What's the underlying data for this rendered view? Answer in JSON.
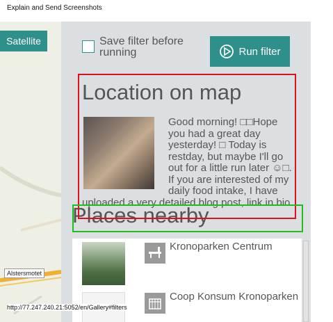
{
  "document": {
    "title": "Explain and Send Screenshots"
  },
  "map": {
    "satellite_label": "Satellite",
    "place_label": "Alstersmotet"
  },
  "filter": {
    "save_filter_label": "Save filter before running",
    "run_filter_label": "Run filter"
  },
  "location": {
    "heading": "Location on map",
    "post_text": "Good morning! □□Hope you had a great day yesterday! □ Today is restday, but maybe I'll go out for a little run later ☺□. If you are interested of my daily food intake, I have uploaded a very detailed blog post, link in bio □"
  },
  "places": {
    "heading": "Places nearby",
    "items": [
      {
        "name": "Kronoparken Centrum",
        "icon": "bench-icon"
      },
      {
        "name": "Coop Konsum Kronoparken",
        "icon": "shop-icon"
      }
    ]
  },
  "status": {
    "url": "http://77.247.240.21:5052/en/Gallery#filters"
  },
  "colors": {
    "accent": "#2f8f8b",
    "highlight_red": "#e0101a",
    "highlight_green": "#1cbf1c"
  }
}
